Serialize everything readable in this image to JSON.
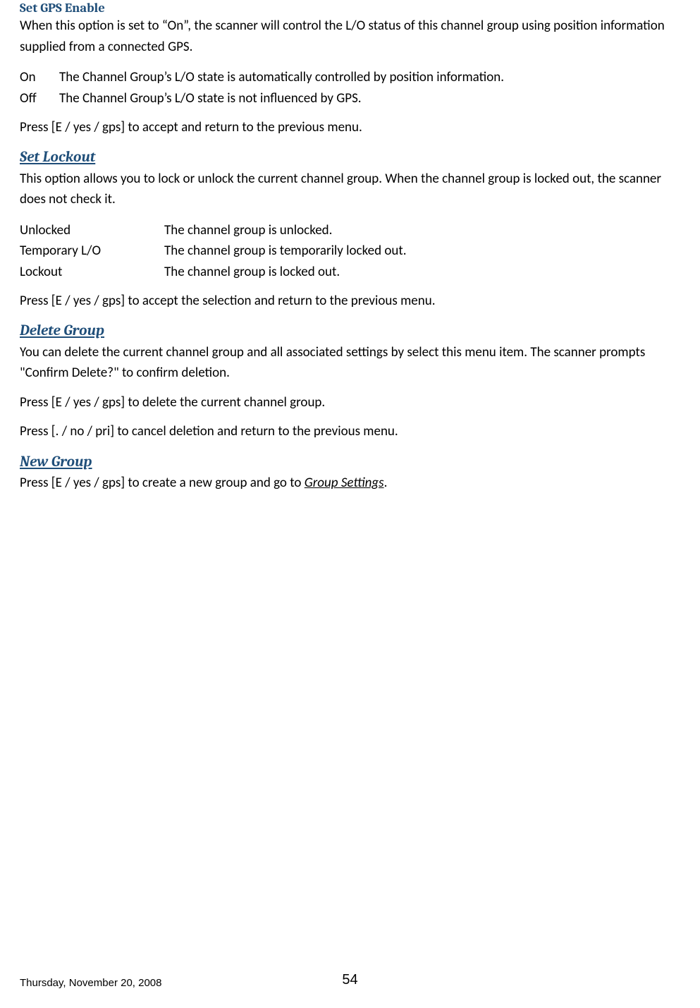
{
  "sec1": {
    "heading": "Set GPS Enable",
    "p1": "When this option is set to “On”, the scanner will control the L/O status of this channel group using position information supplied from a connected GPS.",
    "rows": [
      {
        "k": "On",
        "v": "The Channel Group’s L/O state is automatically controlled by position information."
      },
      {
        "k": "Off",
        "v": "The Channel Group’s L/O state is not influenced by GPS."
      }
    ],
    "p2": "Press [E / yes / gps] to accept and return to the previous menu."
  },
  "sec2": {
    "heading": "Set Lockout",
    "p1": "This option allows you to lock or unlock the current channel group. When the channel group is locked out, the scanner does not check it.",
    "rows": [
      {
        "k": "Unlocked",
        "v": "The channel group is unlocked."
      },
      {
        "k": "Temporary L/O",
        "v": "The channel group is temporarily locked out."
      },
      {
        "k": "Lockout",
        "v": "The channel group is locked out."
      }
    ],
    "p2": "Press [E / yes / gps] to accept the selection and return to the previous menu."
  },
  "sec3": {
    "heading": "Delete Group",
    "p1": "You can delete the current channel group and all associated settings by select this menu item. The scanner prompts \"Confirm Delete?\" to confirm deletion.",
    "p2": "Press [E / yes / gps] to delete the current channel group.",
    "p3": "Press [. / no / pri] to cancel deletion and return to the previous menu."
  },
  "sec4": {
    "heading": "New Group",
    "p1_pre": "Press [E / yes / gps] to create a new group and go to ",
    "p1_link": "Group Settings",
    "p1_post": "."
  },
  "footer": {
    "date": "Thursday, November 20, 2008",
    "page": "54"
  }
}
